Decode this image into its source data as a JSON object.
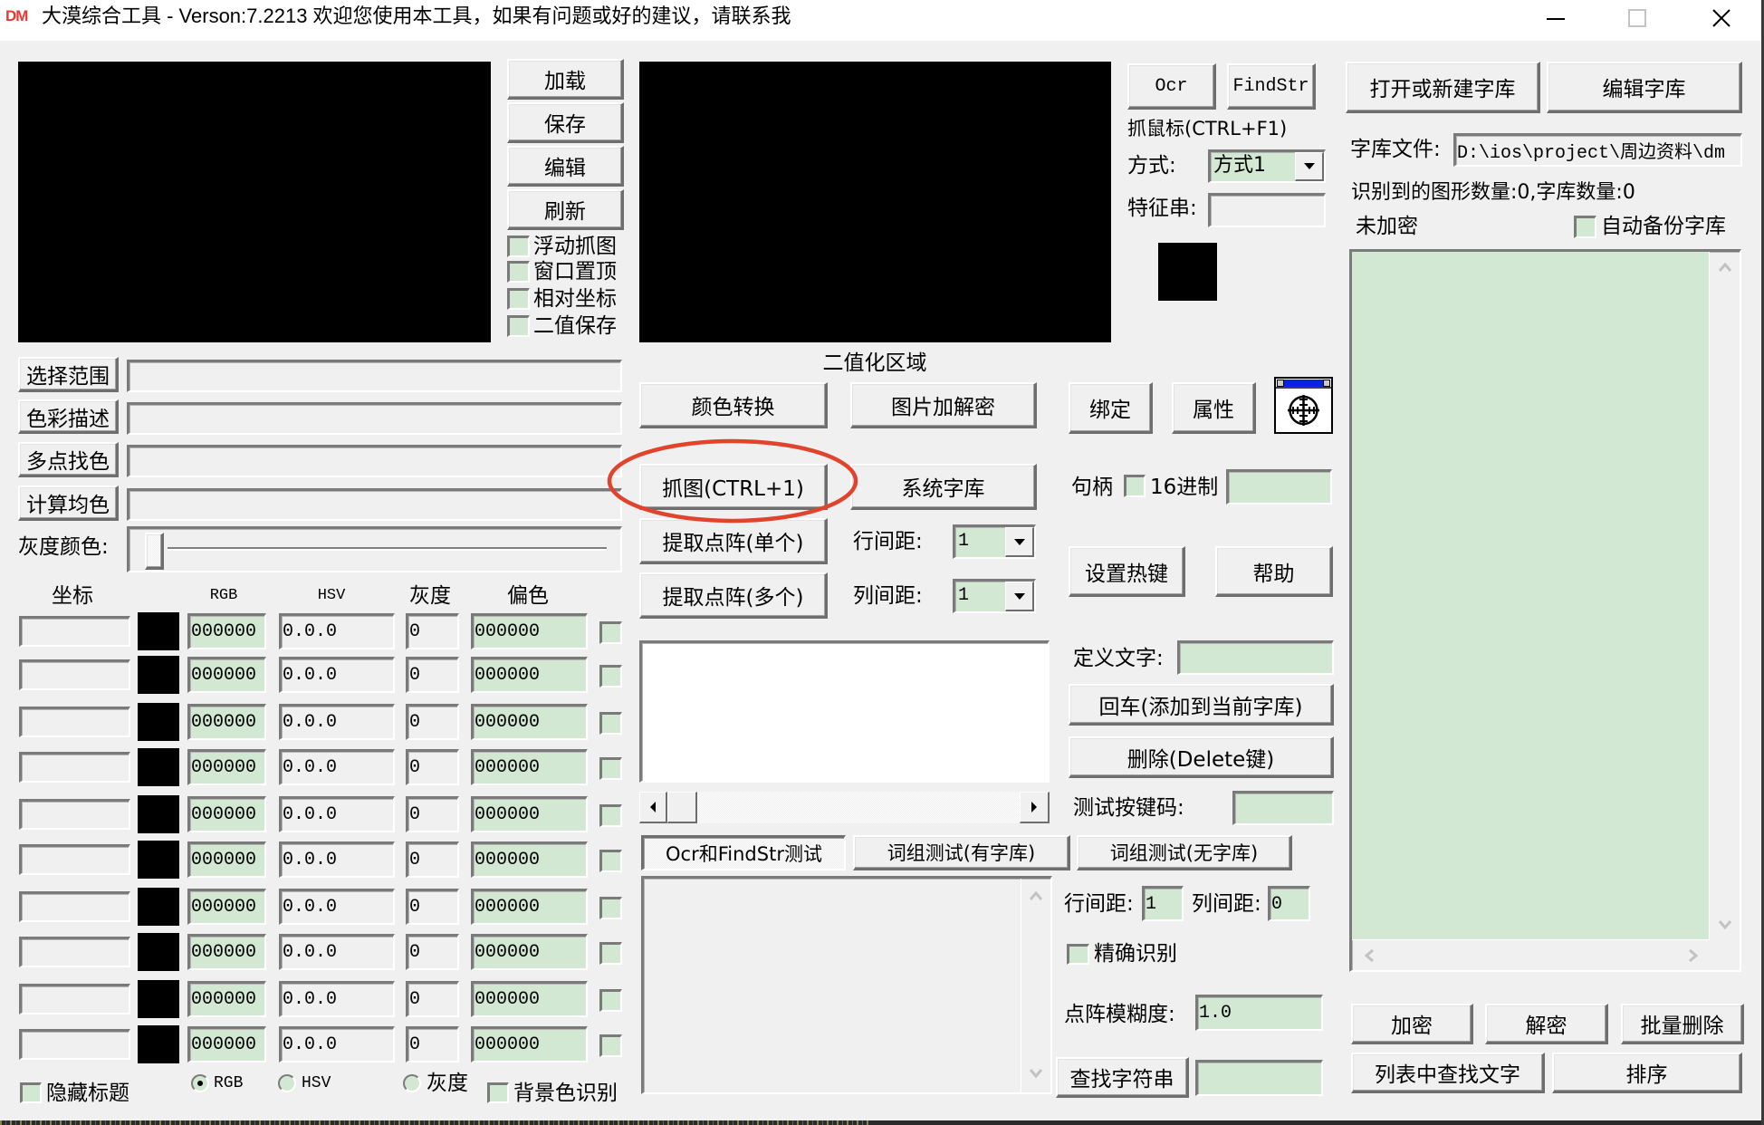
{
  "window": {
    "logo": "DM",
    "title": "大漠综合工具 -  Verson:7.2213  欢迎您使用本工具，如果有问题或好的建议，请联系我",
    "controls": {
      "minimize": "minimize-icon",
      "maximize": "maximize-icon",
      "close": "close-icon"
    }
  },
  "image_tools": {
    "load": "加载",
    "save": "保存",
    "edit": "编辑",
    "refresh": "刷新",
    "options": [
      {
        "label": "浮动抓图",
        "checked": false
      },
      {
        "label": "窗口置顶",
        "checked": false
      },
      {
        "label": "相对坐标",
        "checked": false
      },
      {
        "label": "二值保存",
        "checked": false
      }
    ]
  },
  "color_tools": {
    "select_range": {
      "label": "选择范围",
      "value": ""
    },
    "color_desc": {
      "label": "色彩描述",
      "value": ""
    },
    "multi_point": {
      "label": "多点找色",
      "value": ""
    },
    "avg_color": {
      "label": "计算均色",
      "value": ""
    },
    "gray_color": {
      "label": "灰度颜色:",
      "level": 0
    }
  },
  "color_table": {
    "headers": {
      "coord": "坐标",
      "rgb": "RGB",
      "hsv": "HSV",
      "gray": "灰度",
      "offset": "偏色"
    },
    "rows": [
      {
        "coord": "",
        "swatch": "#000000",
        "rgb": "000000",
        "hsv": "0.0.0",
        "gray": "0",
        "offset": "000000",
        "checked": false
      },
      {
        "coord": "",
        "swatch": "#000000",
        "rgb": "000000",
        "hsv": "0.0.0",
        "gray": "0",
        "offset": "000000",
        "checked": false
      },
      {
        "coord": "",
        "swatch": "#000000",
        "rgb": "000000",
        "hsv": "0.0.0",
        "gray": "0",
        "offset": "000000",
        "checked": false
      },
      {
        "coord": "",
        "swatch": "#000000",
        "rgb": "000000",
        "hsv": "0.0.0",
        "gray": "0",
        "offset": "000000",
        "checked": false
      },
      {
        "coord": "",
        "swatch": "#000000",
        "rgb": "000000",
        "hsv": "0.0.0",
        "gray": "0",
        "offset": "000000",
        "checked": false
      },
      {
        "coord": "",
        "swatch": "#000000",
        "rgb": "000000",
        "hsv": "0.0.0",
        "gray": "0",
        "offset": "000000",
        "checked": false
      },
      {
        "coord": "",
        "swatch": "#000000",
        "rgb": "000000",
        "hsv": "0.0.0",
        "gray": "0",
        "offset": "000000",
        "checked": false
      },
      {
        "coord": "",
        "swatch": "#000000",
        "rgb": "000000",
        "hsv": "0.0.0",
        "gray": "0",
        "offset": "000000",
        "checked": false
      },
      {
        "coord": "",
        "swatch": "#000000",
        "rgb": "000000",
        "hsv": "0.0.0",
        "gray": "0",
        "offset": "000000",
        "checked": false
      },
      {
        "coord": "",
        "swatch": "#000000",
        "rgb": "000000",
        "hsv": "0.0.0",
        "gray": "0",
        "offset": "000000",
        "checked": false
      }
    ]
  },
  "display_options": {
    "hide_title_label": "隐藏标题",
    "hide_title_checked": false,
    "color_modes": [
      {
        "label": "RGB",
        "selected": true
      },
      {
        "label": "HSV",
        "selected": false
      },
      {
        "label": "灰度",
        "selected": false
      }
    ],
    "bg_recog_label": "背景色识别",
    "bg_recog_checked": false
  },
  "binary_panel": {
    "label": "二值化区域",
    "color_convert": "颜色转换",
    "image_crypt": "图片加解密",
    "capture": "抓图(CTRL+1)",
    "system_lib": "系统字库",
    "extract_single": "提取点阵(单个)",
    "extract_multi": "提取点阵(多个)",
    "row_spacing_label": "行间距:",
    "row_spacing_value": "1",
    "col_spacing_label": "列间距:",
    "col_spacing_value": "1",
    "preview_text": ""
  },
  "ocr_panel": {
    "ocr": "Ocr",
    "findstr": "FindStr",
    "grab_mouse": "抓鼠标(CTRL+F1)",
    "mode_label": "方式:",
    "mode_value": "方式1",
    "feature_label": "特征串:",
    "feature_value": "",
    "picked_color": "#000000"
  },
  "window_bind": {
    "bind": "绑定",
    "properties": "属性",
    "finder_icon": "window-finder-crosshair",
    "handle_label": "句柄",
    "hex_label": "16进制",
    "hex_checked": false,
    "handle_value": "",
    "set_hotkey": "设置热键",
    "help": "帮助"
  },
  "char_define": {
    "define_label": "定义文字:",
    "define_value": "",
    "add_button": "回车(添加到当前字库)",
    "delete_button": "删除(Delete键)",
    "test_key_label": "测试按键码:",
    "test_key_value": ""
  },
  "test_tabs": [
    {
      "label": "Ocr和FindStr测试",
      "active": true
    },
    {
      "label": "词组测试(有字库)",
      "active": false
    },
    {
      "label": "词组测试(无字库)",
      "active": false
    }
  ],
  "test_panel": {
    "output": "",
    "row_gap_label": "行间距:",
    "row_gap_value": "1",
    "col_gap_label": "列间距:",
    "col_gap_value": "0",
    "exact_label": "精确识别",
    "exact_checked": false,
    "fuzz_label": "点阵模糊度:",
    "fuzz_value": "1.0",
    "find_button": "查找字符串",
    "find_value": ""
  },
  "library": {
    "open_button": "打开或新建字库",
    "edit_button": "编辑字库",
    "file_label": "字库文件:",
    "file_value": "D:\\ios\\project\\周边资料\\dm",
    "stats": "识别到的图形数量:0,字库数量:0",
    "encryption_status": "未加密",
    "auto_backup_label": "自动备份字库",
    "auto_backup_checked": false,
    "entries": [],
    "encrypt_button": "加密",
    "decrypt_button": "解密",
    "batch_delete_button": "批量删除",
    "find_in_list_button": "列表中查找文字",
    "sort_button": "排序"
  },
  "annotation": {
    "shape": "ellipse",
    "color": "#e0442c"
  },
  "theme": {
    "input_bg": "#d2e8d2",
    "canvas_bg": "#000000"
  }
}
